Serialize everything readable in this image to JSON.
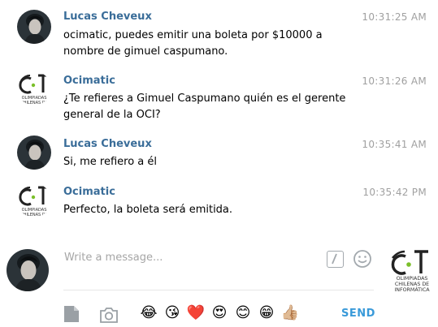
{
  "messages": [
    {
      "author": "Lucas Cheveux",
      "avatar": "lucas-avatar",
      "time": "10:31:25 AM",
      "lines": [
        "ocimatic, puedes emitir una boleta por $10000 a",
        "nombre de gimuel caspumano."
      ]
    },
    {
      "author": "Ocimatic",
      "avatar": "oci-logo",
      "time": "10:31:26 AM",
      "lines": [
        "¿Te refieres a Gimuel Caspumano quién es el gerente",
        "general de la OCI?"
      ]
    },
    {
      "author": "Lucas Cheveux",
      "avatar": "lucas-avatar",
      "time": "10:35:41 AM",
      "lines": [
        "Si, me refiero a él"
      ]
    },
    {
      "author": "Ocimatic",
      "avatar": "oci-logo",
      "time": "10:35:42 PM",
      "lines": [
        "Perfecto, la boleta será emitida."
      ]
    }
  ],
  "oci_logo_text": "OLIMPIADAS CHILENAS DE INFORMÁTICA",
  "composer": {
    "placeholder": "Write a message...",
    "send_label": "SEND",
    "emoji": [
      "😂",
      "😘",
      "❤️",
      "😍",
      "😊",
      "😁",
      "👍🏼"
    ]
  },
  "colors": {
    "author": "#3a6d99",
    "send": "#3a9ad9",
    "timestamp": "#a0a0a0"
  }
}
